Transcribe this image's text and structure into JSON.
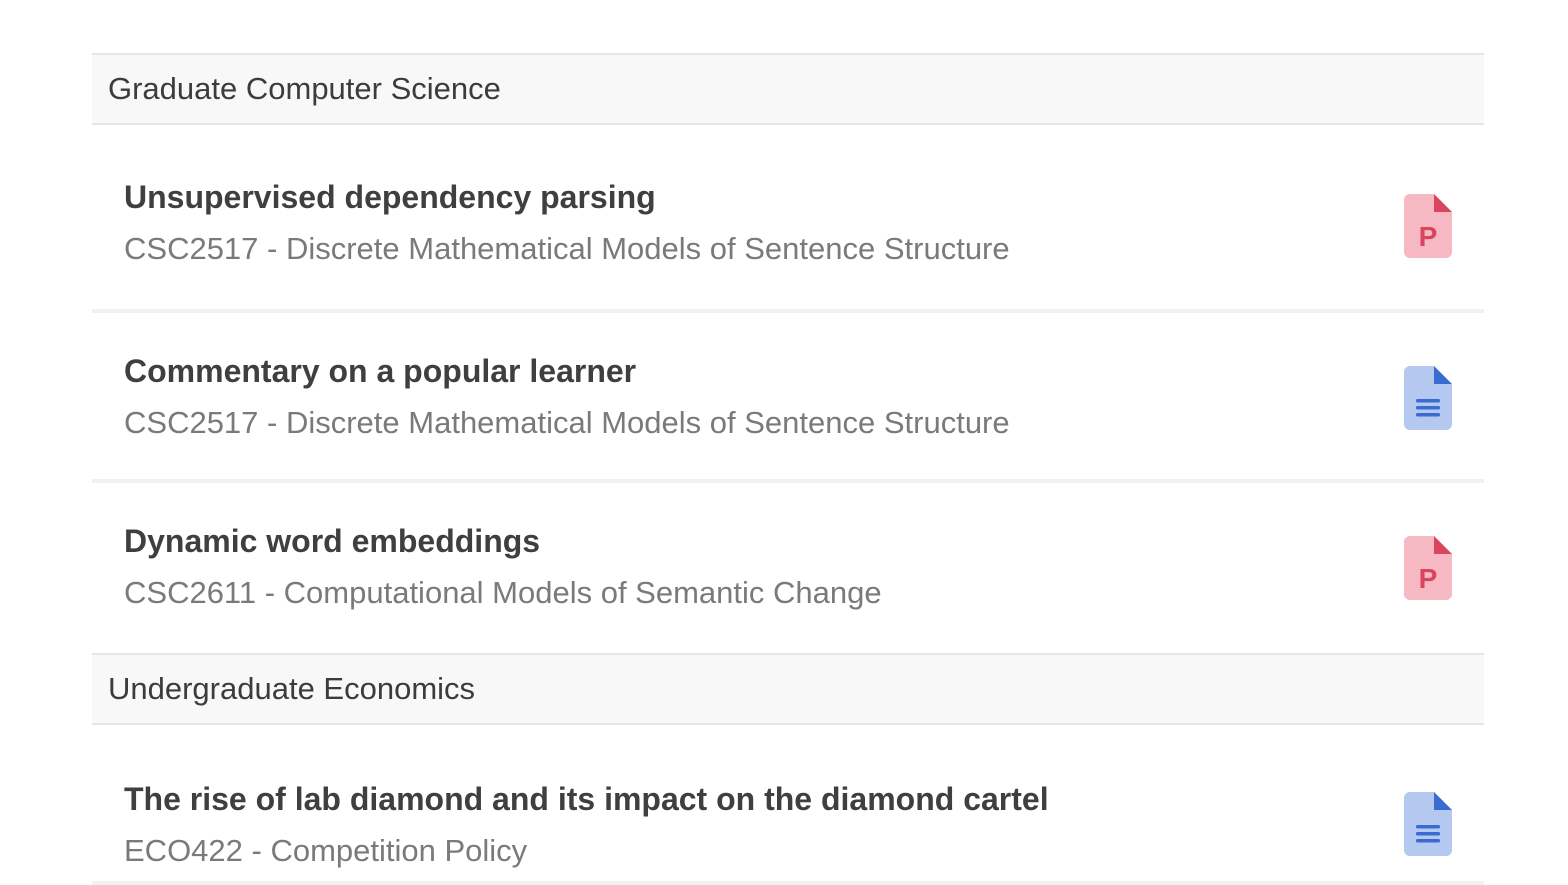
{
  "groups": [
    {
      "name": "Graduate Computer Science",
      "items": [
        {
          "title": "Unsupervised dependency parsing",
          "course": "CSC2517 - Discrete Mathematical Models of Sentence Structure",
          "file_type": "presentation",
          "icon": "presentation-file-icon",
          "icon_letter": "P",
          "icon_colors": {
            "body": "#f6b8c2",
            "fold": "#d9455f",
            "mark": "#d9455f"
          }
        },
        {
          "title": "Commentary on a popular learner",
          "course": "CSC2517 - Discrete Mathematical Models of Sentence Structure",
          "file_type": "document",
          "icon": "document-file-icon",
          "icon_colors": {
            "body": "#b5c8ef",
            "fold": "#3a6bd0",
            "mark": "#3a6bd0"
          }
        },
        {
          "title": "Dynamic word embeddings",
          "course": "CSC2611 - Computational Models of Semantic Change",
          "file_type": "presentation",
          "icon": "presentation-file-icon",
          "icon_letter": "P",
          "icon_colors": {
            "body": "#f6b8c2",
            "fold": "#d9455f",
            "mark": "#d9455f"
          }
        }
      ]
    },
    {
      "name": "Undergraduate Economics",
      "items": [
        {
          "title": "The rise of lab diamond and its impact on the diamond cartel",
          "course": "ECO422 - Competition Policy",
          "file_type": "document",
          "icon": "document-file-icon",
          "icon_colors": {
            "body": "#b5c8ef",
            "fold": "#3a6bd0",
            "mark": "#3a6bd0"
          }
        }
      ]
    }
  ]
}
